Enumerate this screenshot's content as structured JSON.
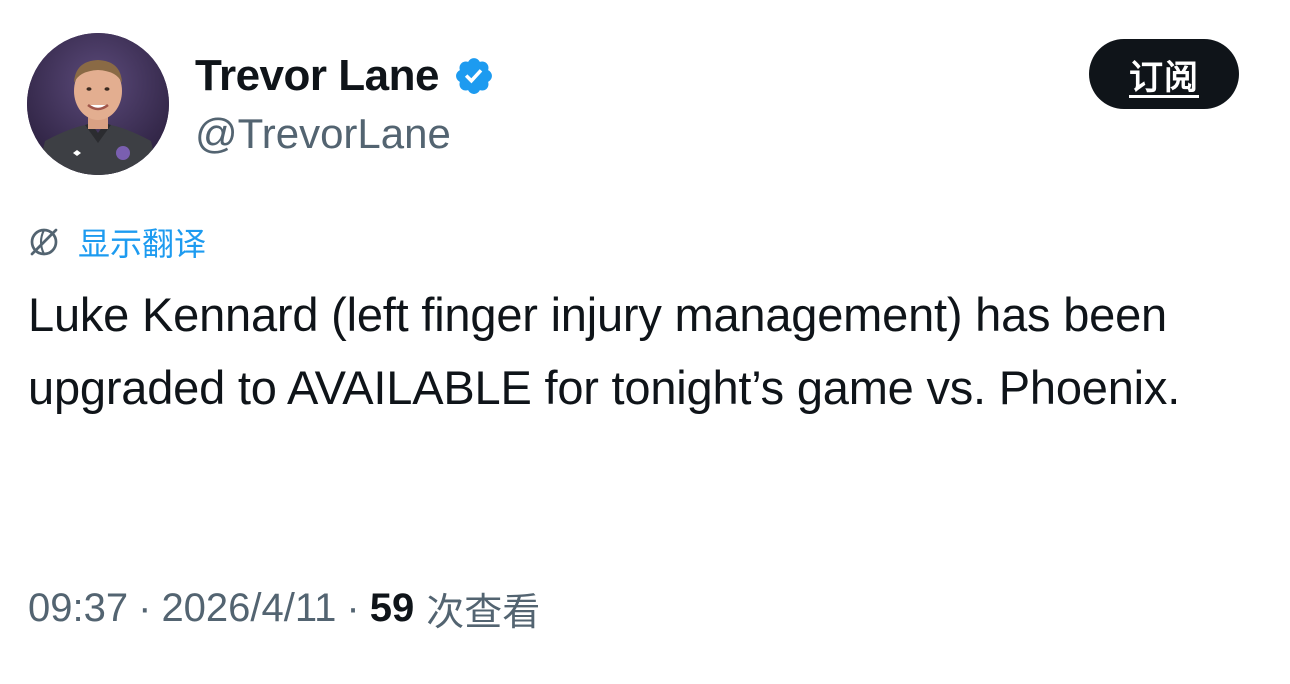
{
  "author": {
    "display_name": "Trevor Lane",
    "handle": "@TrevorLane",
    "verified": true
  },
  "subscribe_button": {
    "label": "订阅"
  },
  "translate": {
    "label": "显示翻译"
  },
  "tweet": {
    "text": "Luke Kennard (left finger injury management) has been upgraded to AVAILABLE for tonight’s game vs. Phoenix."
  },
  "meta": {
    "time": "09:37",
    "separator": "·",
    "date": "2026/4/11",
    "views_count": "59",
    "views_label": "次查看"
  },
  "icons": {
    "verified": "verified-badge-icon",
    "translate": "globe-translate-icon"
  },
  "colors": {
    "text_primary": "#0f1419",
    "text_secondary": "#536471",
    "accent": "#1d9bf0",
    "button_bg": "#0f1419"
  }
}
